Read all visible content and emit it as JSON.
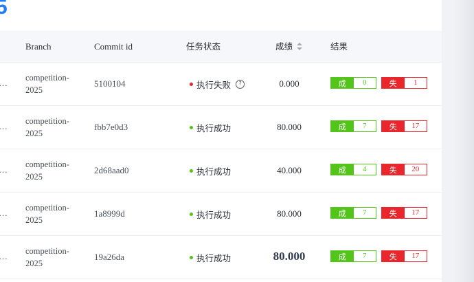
{
  "page": {
    "heading_fragment": "5"
  },
  "table": {
    "headers": {
      "branch": "Branch",
      "commit": "Commit id",
      "status": "任务状态",
      "score": "成绩",
      "result": "结果"
    },
    "success_label": "成功",
    "fail_label": "失败",
    "status_colors": {
      "success": "#52c41a",
      "failed": "#e8262b"
    },
    "rows": [
      {
        "truncated": "…",
        "branch": "competition-2025",
        "commit": "5100104",
        "status": "执行失败",
        "status_type": "failed",
        "has_help": true,
        "score": "0.000",
        "score_emphasis": false,
        "success_count": "0",
        "fail_count": "1"
      },
      {
        "truncated": "…",
        "branch": "competition-2025",
        "commit": "fbb7e0d3",
        "status": "执行成功",
        "status_type": "success",
        "has_help": false,
        "score": "80.000",
        "score_emphasis": false,
        "success_count": "7",
        "fail_count": "17"
      },
      {
        "truncated": "…",
        "branch": "competition-2025",
        "commit": "2d68aad0",
        "status": "执行成功",
        "status_type": "success",
        "has_help": false,
        "score": "40.000",
        "score_emphasis": false,
        "success_count": "4",
        "fail_count": "20"
      },
      {
        "truncated": "…",
        "branch": "competition-2025",
        "commit": "1a8999d",
        "status": "执行成功",
        "status_type": "success",
        "has_help": false,
        "score": "80.000",
        "score_emphasis": false,
        "success_count": "7",
        "fail_count": "17"
      },
      {
        "truncated": "…",
        "branch": "competition-2025",
        "commit": "19a26da",
        "status": "执行成功",
        "status_type": "success",
        "has_help": false,
        "score": "80.000",
        "score_emphasis": true,
        "success_count": "7",
        "fail_count": "17"
      }
    ]
  }
}
